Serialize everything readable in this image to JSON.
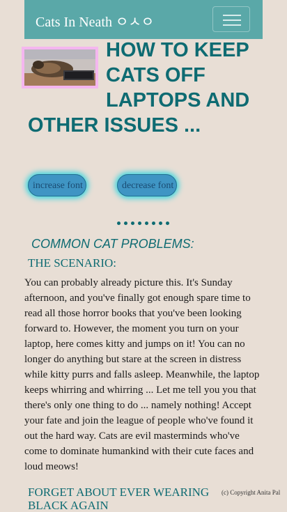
{
  "navbar": {
    "brand": "Cats In Neath ㅇㅅㅇ",
    "toggle_icon": "hamburger-menu-icon"
  },
  "article": {
    "image_alt": "cat lying on laptop",
    "title": "HOW TO KEEP CATS OFF LAPTOPS AND OTHER ISSUES ...",
    "increase_font": "increase font",
    "decrease_font": "decrease font",
    "separator": "••••••••",
    "section_heading": "COMMON CAT PROBLEMS:",
    "scenario_heading": "THE SCENARIO:",
    "scenario_text": "You can probably already picture this. It's Sunday afternoon, and you've finally got enough spare time to read all those horror books that you've been looking forward to. However, the moment you turn on your laptop, here comes kitty and jumps on it! You can no longer do anything but stare at the screen in distress while kitty purrs and falls asleep. Meanwhile, the laptop keeps whirring and whirring ... Let me tell you you that there's only one thing to do ... namely nothing! Accept your fate and join the league of people who've found it out the hard way. Cats are evil masterminds who've come to dominate humankind with their cute faces and loud meows!",
    "next_heading": "FORGET ABOUT EVER WEARING BLACK AGAIN"
  },
  "footer": {
    "copyright": "(c) Copyright Anita Pal"
  },
  "colors": {
    "background": "#e8ded5",
    "navbar": "#5aa8a8",
    "accent": "#0e6b72",
    "button": "#3f95c4",
    "image_border": "#f4b6ef"
  }
}
